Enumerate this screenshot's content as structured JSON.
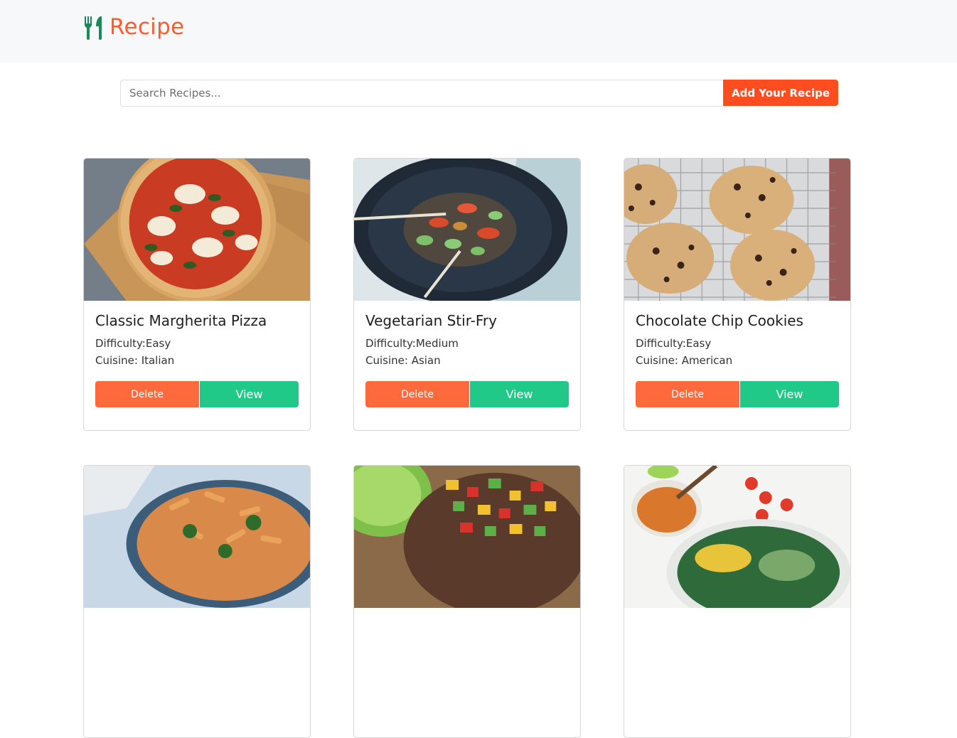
{
  "brand": {
    "name": "Recipe",
    "icon": "utensils-icon",
    "color": "#ff5b2e"
  },
  "search": {
    "placeholder": "Search Recipes...",
    "value": ""
  },
  "add_button": {
    "label": "Add Your Recipe"
  },
  "colors": {
    "accent": "#ff4d1f",
    "delete": "#ff6a3d",
    "view": "#20c988",
    "brand_icon": "#1a8a5a"
  },
  "recipes": [
    {
      "title": "Classic Margherita Pizza",
      "difficulty": "Difficulty:Easy",
      "cuisine": "Cuisine: Italian",
      "image": "pizza-image",
      "delete_label": "Delete",
      "view_label": "View"
    },
    {
      "title": "Vegetarian Stir-Fry",
      "difficulty": "Difficulty:Medium",
      "cuisine": "Cuisine: Asian",
      "image": "stir-fry-image",
      "delete_label": "Delete",
      "view_label": "View"
    },
    {
      "title": "Chocolate Chip Cookies",
      "difficulty": "Difficulty:Easy",
      "cuisine": "Cuisine: American",
      "image": "cookies-image",
      "delete_label": "Delete",
      "view_label": "View"
    },
    {
      "image": "pasta-image"
    },
    {
      "image": "salsa-image"
    },
    {
      "image": "salad-bowl-image"
    }
  ]
}
